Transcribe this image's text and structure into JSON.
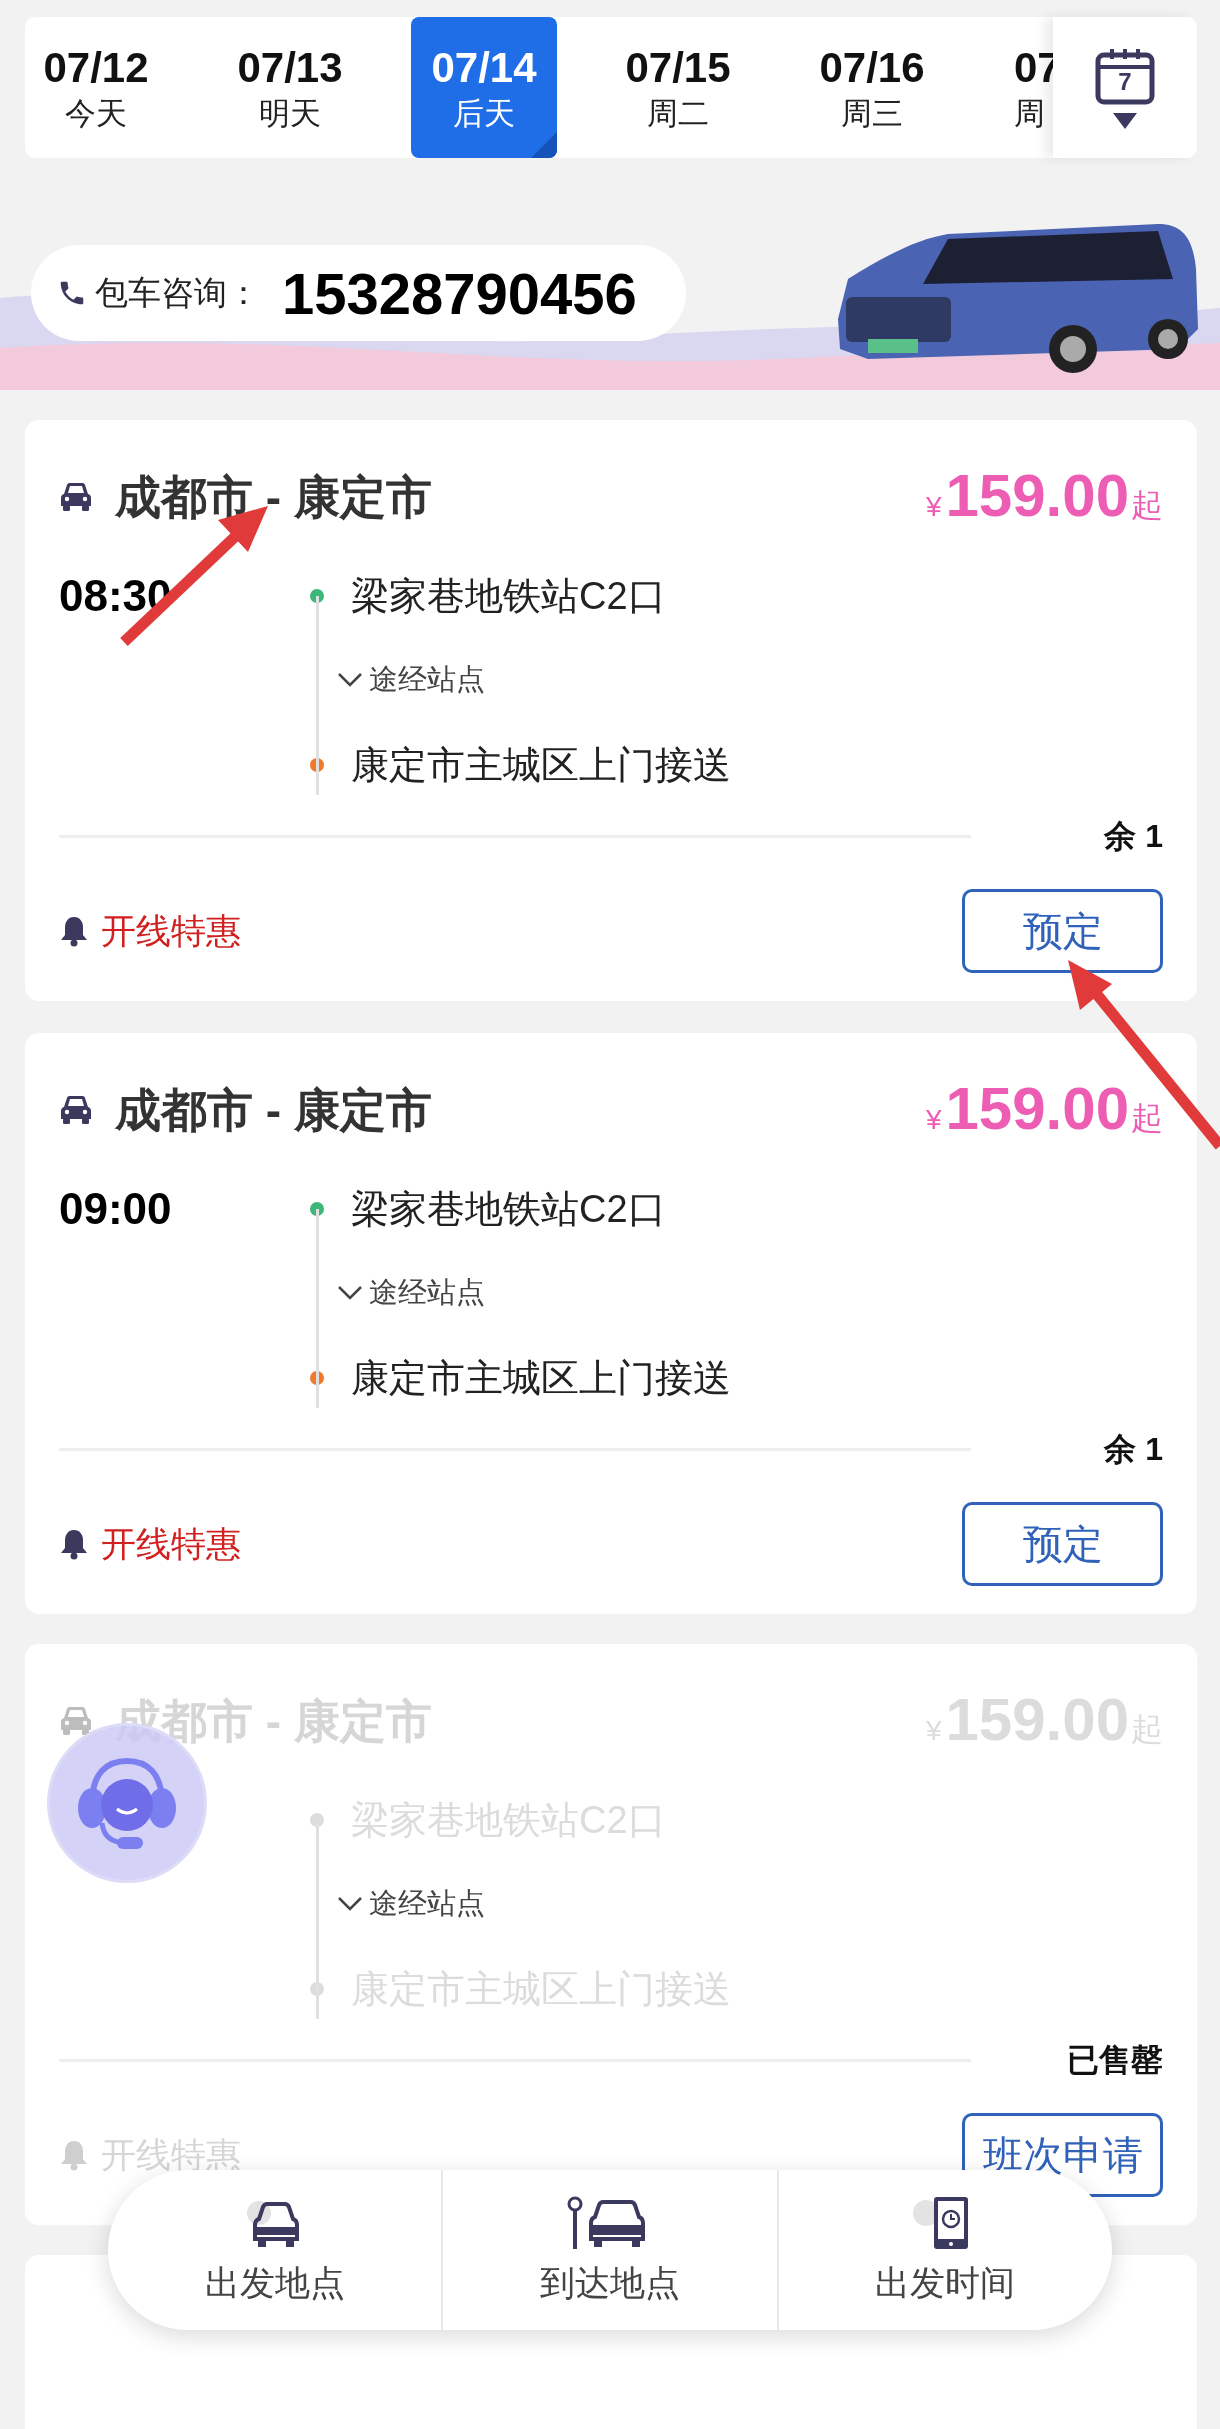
{
  "date_tabs": [
    {
      "date": "07/12",
      "day": "今天",
      "selected": false
    },
    {
      "date": "07/13",
      "day": "明天",
      "selected": false
    },
    {
      "date": "07/14",
      "day": "后天",
      "selected": true
    },
    {
      "date": "07/15",
      "day": "周二",
      "selected": false
    },
    {
      "date": "07/16",
      "day": "周三",
      "selected": false
    },
    {
      "date": "07",
      "day": "周",
      "selected": false
    }
  ],
  "calendar_button": {
    "day": "7"
  },
  "banner": {
    "label": "包车咨询：",
    "phone": "15328790456"
  },
  "trips": [
    {
      "route": "成都市 - 康定市",
      "currency": "¥",
      "price": "159.00",
      "price_suffix": "起",
      "time": "08:30",
      "stops": [
        {
          "name": "梁家巷地铁站C2口",
          "color": "#3cb878"
        },
        {
          "name": "康定市主城区上门接送",
          "color": "#f07a2a"
        }
      ],
      "via_label": "途经站点",
      "seats": "余 1",
      "promo": "开线特惠",
      "action": "预定",
      "sold_out": false
    },
    {
      "route": "成都市 - 康定市",
      "currency": "¥",
      "price": "159.00",
      "price_suffix": "起",
      "time": "09:00",
      "stops": [
        {
          "name": "梁家巷地铁站C2口",
          "color": "#3cb878"
        },
        {
          "name": "康定市主城区上门接送",
          "color": "#f07a2a"
        }
      ],
      "via_label": "途经站点",
      "seats": "余 1",
      "promo": "开线特惠",
      "action": "预定",
      "sold_out": false
    },
    {
      "route": "成都市 - 康定市",
      "currency": "¥",
      "price": "159.00",
      "price_suffix": "起",
      "stops": [
        {
          "name": "梁家巷地铁站C2口"
        },
        {
          "name": "康定市主城区上门接送"
        }
      ],
      "via_label": "途经站点",
      "seats": "已售罄",
      "promo": "开线特惠",
      "action": "班次申请",
      "sold_out": true
    }
  ],
  "bottom_nav": [
    {
      "label": "出发地点",
      "kind": "departure"
    },
    {
      "label": "到达地点",
      "kind": "arrival"
    },
    {
      "label": "出发时间",
      "kind": "time"
    }
  ]
}
